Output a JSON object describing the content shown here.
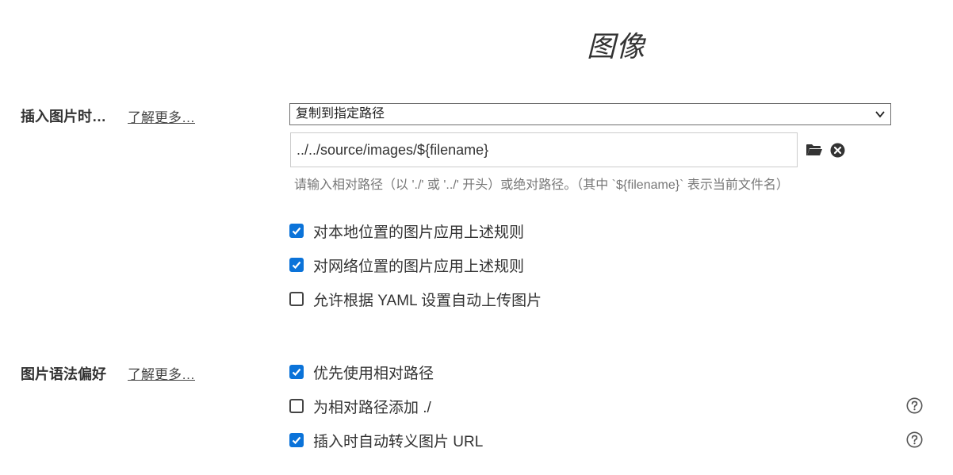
{
  "page": {
    "title": "图像"
  },
  "insert_section": {
    "label": "插入图片时…",
    "learn_more": "了解更多…",
    "select": {
      "selected": "复制到指定路径"
    },
    "path": {
      "value": "../../source/images/${filename}",
      "hint": "请输入相对路径（以 './' 或 '../' 开头）或绝对路径。（其中 `${filename}` 表示当前文件名）"
    },
    "options": [
      {
        "label": "对本地位置的图片应用上述规则",
        "checked": true
      },
      {
        "label": "对网络位置的图片应用上述规则",
        "checked": true
      },
      {
        "label": "允许根据 YAML 设置自动上传图片",
        "checked": false
      }
    ]
  },
  "syntax_section": {
    "label": "图片语法偏好",
    "learn_more": "了解更多…",
    "options": [
      {
        "label": "优先使用相对路径",
        "checked": true,
        "help": false
      },
      {
        "label": "为相对路径添加 ./",
        "checked": false,
        "help": true
      },
      {
        "label": "插入时自动转义图片 URL",
        "checked": true,
        "help": true
      }
    ]
  },
  "icons": {
    "folder": "folder-icon",
    "clear": "clear-icon",
    "help": "question-circle-icon",
    "dropdown": "chevron-down-icon",
    "check": "checkmark-icon"
  },
  "colors": {
    "checkbox_checked": "#0b73d9",
    "text": "#333333",
    "hint": "#777777"
  }
}
